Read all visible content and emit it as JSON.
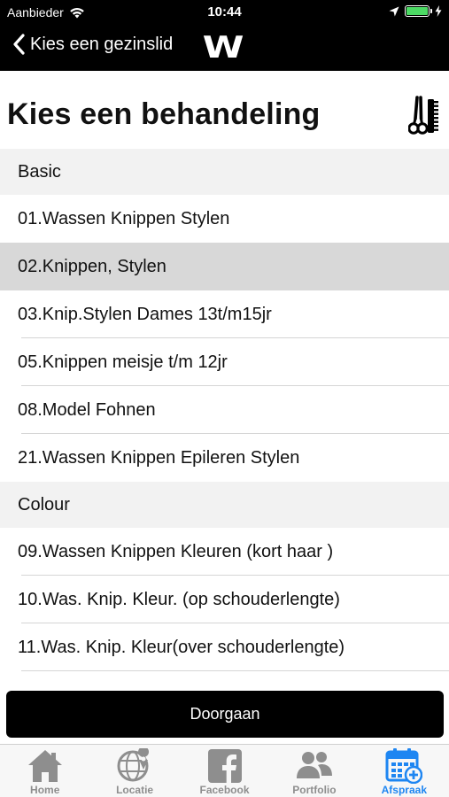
{
  "status_bar": {
    "carrier": "Aanbieder",
    "time": "10:44",
    "battery_level": 1.0
  },
  "nav": {
    "back_label": "Kies een gezinslid",
    "logo_text": "W"
  },
  "page": {
    "title": "Kies een behandeling"
  },
  "sections": [
    {
      "header": "Basic",
      "items": [
        "01.Wassen Knippen Stylen",
        "02.Knippen, Stylen",
        "03.Knip.Stylen Dames 13t/m15jr",
        "05.Knippen meisje t/m 12jr",
        "08.Model Fohnen",
        "21.Wassen Knippen Epileren Stylen"
      ]
    },
    {
      "header": "Colour",
      "items": [
        "09.Wassen Knippen Kleuren (kort haar )",
        "10.Was. Knip. Kleur. (op schouderlengte)",
        "11.Was. Knip. Kleur(over schouderlengte)"
      ]
    }
  ],
  "selected_item": "02.Knippen, Stylen",
  "continue_label": "Doorgaan",
  "tabs": [
    {
      "label": "Home",
      "icon": "home-icon"
    },
    {
      "label": "Locatie",
      "icon": "globe-pin-icon"
    },
    {
      "label": "Facebook",
      "icon": "facebook-icon"
    },
    {
      "label": "Portfolio",
      "icon": "people-icon"
    },
    {
      "label": "Afspraak",
      "icon": "calendar-add-icon"
    }
  ],
  "active_tab": "Afspraak",
  "colors": {
    "header_bg": "#000000",
    "accent": "#1e86f2",
    "selected_row": "#d8d8d8",
    "section_bg": "#f2f2f2",
    "battery": "#4cd964"
  }
}
